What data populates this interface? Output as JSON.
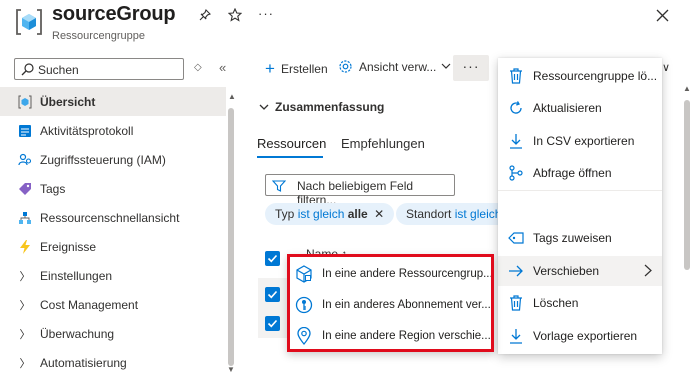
{
  "header": {
    "title": "sourceGroup",
    "subtitle": "Ressourcengruppe",
    "more_label": "···"
  },
  "sidebar": {
    "search_placeholder": "Suchen",
    "items": [
      {
        "label": "Übersicht",
        "icon": "resource-group-icon",
        "active": true
      },
      {
        "label": "Aktivitätsprotokoll",
        "icon": "activity-log-icon"
      },
      {
        "label": "Zugriffssteuerung (IAM)",
        "icon": "iam-people-icon"
      },
      {
        "label": "Tags",
        "icon": "tag-icon"
      },
      {
        "label": "Ressourcenschnellansicht",
        "icon": "resource-visualizer-icon"
      },
      {
        "label": "Ereignisse",
        "icon": "lightning-icon"
      },
      {
        "label": "Einstellungen",
        "icon": "chevron-right-icon"
      },
      {
        "label": "Cost Management",
        "icon": "chevron-right-icon"
      },
      {
        "label": "Überwachung",
        "icon": "chevron-right-icon"
      },
      {
        "label": "Automatisierung",
        "icon": "chevron-right-icon"
      }
    ]
  },
  "toolbar": {
    "create_label": "Erstellen",
    "view_label": "Ansicht verw...",
    "more_label": "···"
  },
  "main": {
    "summary_label": "Zusammenfassung",
    "tabs": [
      {
        "label": "Ressourcen",
        "active": true
      },
      {
        "label": "Empfehlungen"
      }
    ],
    "filter_placeholder": "Nach beliebigem Feld filtern...",
    "pills": {
      "type": {
        "field": "Typ",
        "op": "ist gleich",
        "value": "alle"
      },
      "location": {
        "field": "Standort",
        "op": "ist gleich"
      }
    },
    "name_header": "Name ↑"
  },
  "context_menu": {
    "items": [
      {
        "label": "Ressourcengruppe lö...",
        "icon": "trash-icon"
      },
      {
        "label": "Aktualisieren",
        "icon": "refresh-icon"
      },
      {
        "label": "In CSV exportieren",
        "icon": "download-icon"
      },
      {
        "label": "Abfrage öffnen",
        "icon": "query-icon"
      },
      {
        "label": "Tags zuweisen",
        "icon": "tag-outline-icon"
      },
      {
        "label": "Verschieben",
        "icon": "arrow-right-icon",
        "highlighted": true
      },
      {
        "label": "Löschen",
        "icon": "trash-icon"
      },
      {
        "label": "Vorlage exportieren",
        "icon": "download-icon"
      }
    ]
  },
  "submenu": {
    "items": [
      {
        "label": "In eine andere Ressourcengrup...",
        "icon": "cube-icon"
      },
      {
        "label": "In ein anderes Abonnement ver...",
        "icon": "key-icon"
      },
      {
        "label": "In eine andere Region verschie...",
        "icon": "location-pin-icon"
      }
    ]
  },
  "colors": {
    "accent": "#0078d4",
    "highlight_border": "#e00b1c",
    "active_bg": "#edebe9"
  }
}
